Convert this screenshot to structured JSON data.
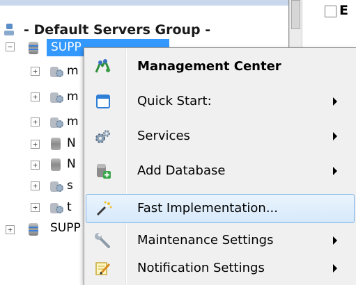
{
  "right_pane": {
    "label": "E"
  },
  "tree": {
    "group_label": "- Default Servers Group -",
    "selected_server": "SUPP",
    "child_labels": [
      "m",
      "m",
      "m",
      "N",
      "N",
      "s",
      "t"
    ],
    "second_server": "SUPP"
  },
  "context_menu": {
    "items": [
      {
        "label": "Management Center",
        "bold": true,
        "submenu": false,
        "icon": "management-center-icon"
      },
      {
        "label": "Quick Start:",
        "bold": false,
        "submenu": true,
        "icon": "window-icon"
      },
      {
        "label": "Services",
        "bold": false,
        "submenu": true,
        "icon": "gears-icon"
      },
      {
        "label": "Add Database",
        "bold": false,
        "submenu": true,
        "icon": "add-database-icon"
      },
      {
        "label": "Fast Implementation...",
        "bold": false,
        "submenu": false,
        "highlighted": true,
        "icon": "magic-wand-icon"
      },
      {
        "label": "Maintenance Settings",
        "bold": false,
        "submenu": true,
        "icon": "wrench-icon"
      },
      {
        "label": "Notification Settings",
        "bold": false,
        "submenu": true,
        "icon": "notepad-pencil-icon"
      }
    ]
  },
  "colors": {
    "selection": "#3399ff",
    "menu_background": "#f0f0f0",
    "highlight_border": "#7eb4ea"
  }
}
